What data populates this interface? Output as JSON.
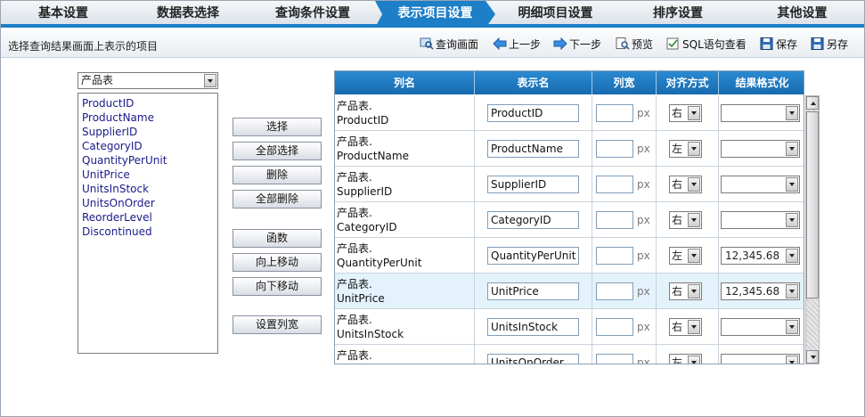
{
  "tabs": [
    {
      "label": "基本设置"
    },
    {
      "label": "数据表选择"
    },
    {
      "label": "查询条件设置"
    },
    {
      "label": "表示项目设置"
    },
    {
      "label": "明细项目设置"
    },
    {
      "label": "排序设置"
    },
    {
      "label": "其他设置"
    }
  ],
  "toolbar": {
    "hint": "选择查询结果画面上表示的项目",
    "query_screen": "查询画面",
    "prev_step": "上一步",
    "next_step": "下一步",
    "preview": "预览",
    "sql_view": "SQL语句查看",
    "save": "保存",
    "save_as": "另存"
  },
  "left": {
    "table_select": "产品表",
    "columns": [
      "ProductID",
      "ProductName",
      "SupplierID",
      "CategoryID",
      "QuantityPerUnit",
      "UnitPrice",
      "UnitsInStock",
      "UnitsOnOrder",
      "ReorderLevel",
      "Discontinued"
    ],
    "buttons": {
      "select": "选择",
      "select_all": "全部选择",
      "delete": "删除",
      "delete_all": "全部删除",
      "function": "函数",
      "move_up": "向上移动",
      "move_down": "向下移动",
      "set_width": "设置列宽"
    }
  },
  "grid": {
    "headers": {
      "col_name": "列名",
      "display_name": "表示名",
      "width": "列宽",
      "align": "对齐方式",
      "format": "结果格式化"
    },
    "unit": "px",
    "rows": [
      {
        "table": "产品表.",
        "column": "ProductID",
        "display": "ProductID",
        "align": "右",
        "format": ""
      },
      {
        "table": "产品表.",
        "column": "ProductName",
        "display": "ProductName",
        "align": "左",
        "format": ""
      },
      {
        "table": "产品表.",
        "column": "SupplierID",
        "display": "SupplierID",
        "align": "右",
        "format": ""
      },
      {
        "table": "产品表.",
        "column": "CategoryID",
        "display": "CategoryID",
        "align": "右",
        "format": ""
      },
      {
        "table": "产品表.",
        "column": "QuantityPerUnit",
        "display": "QuantityPerUnit",
        "align": "左",
        "format": "12,345.68"
      },
      {
        "table": "产品表.",
        "column": "UnitPrice",
        "display": "UnitPrice",
        "align": "右",
        "format": "12,345.68"
      },
      {
        "table": "产品表.",
        "column": "UnitsInStock",
        "display": "UnitsInStock",
        "align": "右",
        "format": ""
      },
      {
        "table": "产品表.",
        "column": "UnitsOnOrder",
        "display": "UnitsOnOrder",
        "align": "左",
        "format": ""
      }
    ]
  },
  "icons": {
    "query_screen": "magnifier-screen-icon",
    "prev": "arrow-left-icon",
    "next": "arrow-right-icon",
    "preview": "preview-icon",
    "sql": "sql-check-icon",
    "save": "floppy-disk-icon",
    "save_as": "floppy-save-as-icon"
  },
  "colors": {
    "accent": "#1c7fc7",
    "header": "#1f7bc0",
    "link_text": "#1a1a8a"
  }
}
